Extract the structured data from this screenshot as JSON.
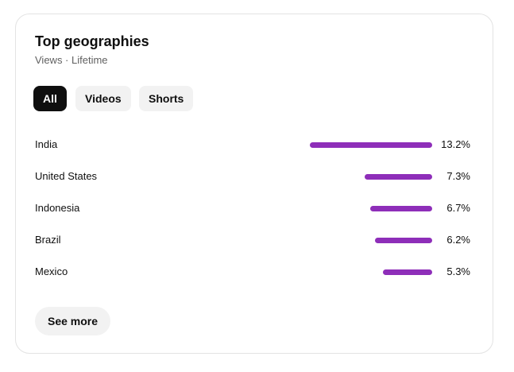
{
  "card": {
    "title": "Top geographies",
    "subtitle": "Views · Lifetime"
  },
  "filters": {
    "selected": "All",
    "items": [
      {
        "label": "All"
      },
      {
        "label": "Videos"
      },
      {
        "label": "Shorts"
      }
    ]
  },
  "geographies": [
    {
      "country": "India",
      "percent_label": "13.2%",
      "percent": 13.2
    },
    {
      "country": "United States",
      "percent_label": "7.3%",
      "percent": 7.3
    },
    {
      "country": "Indonesia",
      "percent_label": "6.7%",
      "percent": 6.7
    },
    {
      "country": "Brazil",
      "percent_label": "6.2%",
      "percent": 6.2
    },
    {
      "country": "Mexico",
      "percent_label": "5.3%",
      "percent": 5.3
    }
  ],
  "see_more_label": "See more",
  "colors": {
    "bar": "#8e2eb9",
    "selected_chip_bg": "#0f0f0f",
    "chip_bg": "#f2f2f2"
  }
}
